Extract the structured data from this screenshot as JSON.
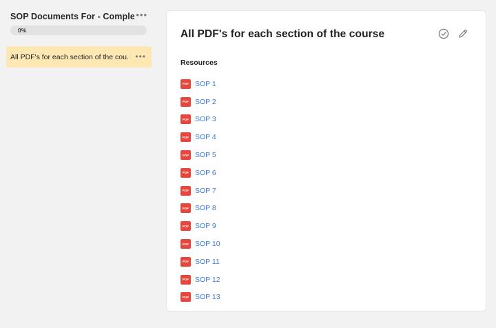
{
  "sidebar": {
    "course_title": "SOP Documents For - Complete ...",
    "course_menu_icon": "more-horizontal-icon",
    "progress_label": "0%",
    "progress_fraction": 0,
    "sections": [
      {
        "label": "All PDF's for each section of the cou...",
        "menu_icon": "more-horizontal-icon"
      }
    ]
  },
  "main": {
    "title": "All PDF's for each section of the course",
    "actions": [
      {
        "icon": "check-circle-icon"
      },
      {
        "icon": "pencil-icon"
      }
    ],
    "resources_label": "Resources",
    "pdf_badge_text": "PDF",
    "resources": [
      {
        "label": "SOP 1"
      },
      {
        "label": "SOP 2"
      },
      {
        "label": "SOP 3"
      },
      {
        "label": "SOP 4"
      },
      {
        "label": "SOP 5"
      },
      {
        "label": "SOP 6"
      },
      {
        "label": "SOP 7"
      },
      {
        "label": "SOP 8"
      },
      {
        "label": "SOP 9"
      },
      {
        "label": "SOP 10"
      },
      {
        "label": "SOP 11"
      },
      {
        "label": "SOP 12"
      },
      {
        "label": "SOP 13"
      }
    ]
  },
  "colors": {
    "background": "#f2f2f2",
    "active_section": "#fde7b2",
    "link": "#3c7bd6",
    "pdf_badge": "#e8453c"
  }
}
